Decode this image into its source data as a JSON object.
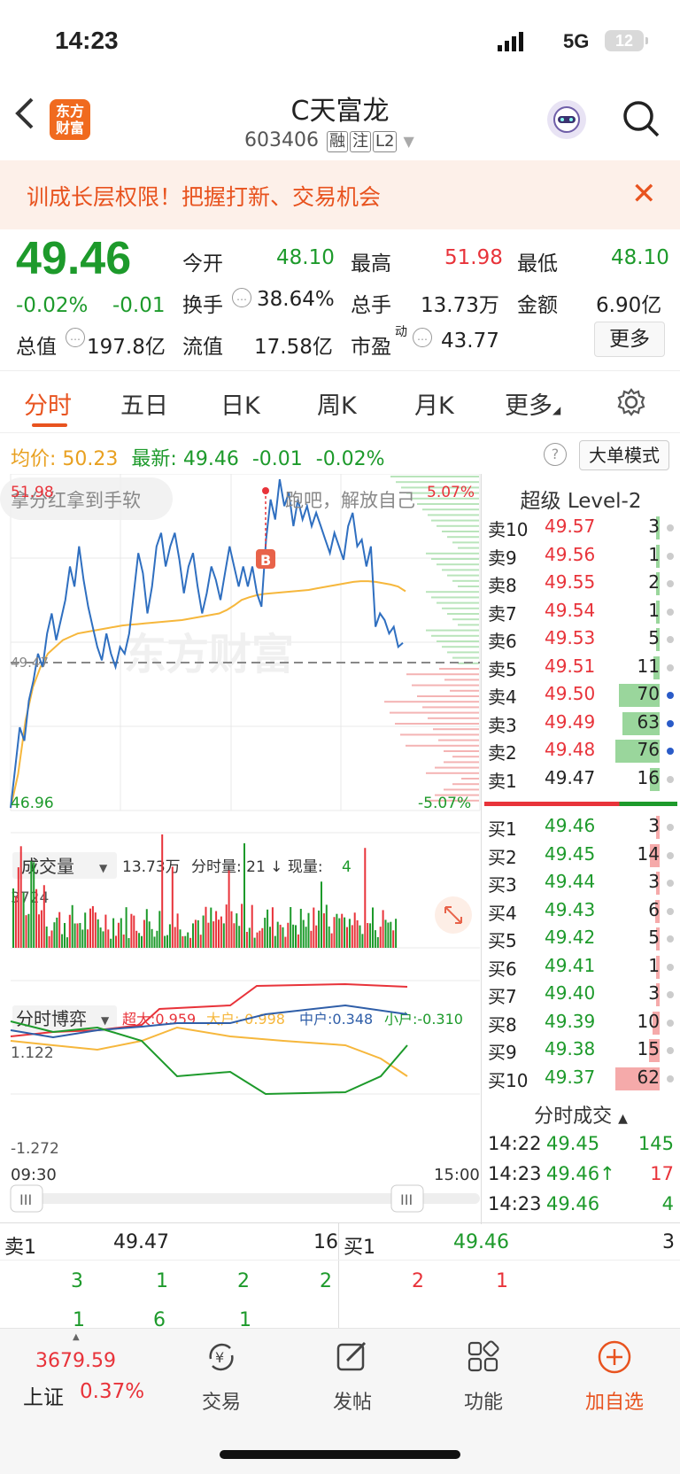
{
  "status_bar": {
    "time": "14:23",
    "network": "5G",
    "battery": "12"
  },
  "header": {
    "back_icon": "chevron-left-icon",
    "logo_text": "东方财富",
    "stock_name": "C天富龙",
    "stock_code": "603406",
    "tags": [
      "融",
      "注",
      "L2"
    ],
    "robot_icon": "robot-assistant-icon",
    "search_icon": "search-icon"
  },
  "banner": {
    "text": "训成长层权限！把握打新、交易机会",
    "close_icon": "close-icon"
  },
  "quote": {
    "price": "49.46",
    "change_pct": "-0.02%",
    "change": "-0.01",
    "open_label": "今开",
    "open": "48.10",
    "high_label": "最高",
    "high": "51.98",
    "low_label": "最低",
    "low": "48.10",
    "turnover_label": "换手",
    "turnover": "38.64%",
    "volume_label": "总手",
    "volume": "13.73万",
    "amount_label": "金额",
    "amount": "6.90亿",
    "mktcap_label": "总值",
    "mktcap": "197.8亿",
    "float_label": "流值",
    "float": "17.58亿",
    "pe_label": "市盈",
    "pe_sup": "动",
    "pe": "43.77",
    "more_button": "更多"
  },
  "tabs": [
    "分时",
    "五日",
    "日K",
    "周K",
    "月K",
    "更多"
  ],
  "settings_icon": "gear-icon",
  "chart_header": {
    "avg_label": "均价:",
    "avg_value": "50.23",
    "latest_label": "最新:",
    "latest_value": "49.46",
    "latest_change": "-0.01",
    "latest_pct": "-0.02%",
    "big_order_button": "大单模式"
  },
  "chart_labels": {
    "top_price": "51.98",
    "bottom_price": "46.96",
    "top_pct": "5.07%",
    "bottom_pct": "-5.07%",
    "mid_price": "49.47",
    "watermark": "东方财富",
    "overlay_left": "拿分红拿到手软",
    "overlay_right": "跑吧，解放自己",
    "b_marker": "B",
    "vol_select": "成交量",
    "vol_info_total": "13.73万",
    "vol_info_rest": "分时量: 21 ↓ 现量:",
    "vol_info_now": "4",
    "vol_max": "3724",
    "game_select": "分时博弈",
    "game_super": "超大:0.959",
    "game_large": "大户:-0.998",
    "game_mid": "中户:0.348",
    "game_small": "小户:-0.310",
    "game_max": "1.122",
    "game_min": "-1.272",
    "time_start": "09:30",
    "time_end": "15:00"
  },
  "chart_data": {
    "type": "line",
    "y_range": [
      46.96,
      51.98
    ],
    "pct_range": [
      "-5.07%",
      "5.07%"
    ],
    "reference_price": 49.47,
    "series": [
      {
        "name": "最新",
        "values": [
          47.0,
          47.6,
          48.2,
          48.0,
          48.6,
          48.9,
          49.3,
          49.1,
          49.6,
          49.9,
          49.5,
          49.8,
          50.1,
          50.6,
          50.3,
          50.9,
          50.4,
          50.0,
          49.7,
          49.4,
          49.2,
          49.6,
          49.3,
          49.1,
          49.4,
          49.3,
          49.6,
          50.2,
          50.8,
          50.5,
          49.9,
          50.3,
          50.9,
          51.1,
          50.6,
          50.9,
          51.1,
          50.7,
          50.2,
          50.6,
          50.8,
          50.3,
          49.9,
          50.2,
          50.6,
          50.4,
          50.1,
          50.5,
          50.9,
          50.6,
          50.3,
          50.6,
          50.3,
          50.6,
          50.2,
          50.0,
          51.0,
          51.6,
          51.3,
          51.9,
          51.5,
          51.7,
          51.2,
          51.6,
          51.3,
          51.5,
          51.2,
          51.4,
          51.2,
          51.0,
          50.8,
          51.1,
          50.9,
          50.7,
          51.2,
          51.4,
          50.9,
          51.0,
          50.6,
          50.9,
          49.7,
          49.9,
          49.8,
          49.6,
          49.7,
          49.4,
          49.46
        ]
      },
      {
        "name": "均价",
        "values": [
          47.0,
          47.5,
          48.3,
          48.8,
          49.1,
          49.3,
          49.4,
          49.5,
          49.55,
          49.6,
          49.62,
          49.64,
          49.66,
          49.68,
          49.7,
          49.72,
          49.73,
          49.74,
          49.75,
          49.76,
          49.77,
          49.78,
          49.79,
          49.8,
          49.82,
          49.84,
          49.86,
          49.88,
          49.9,
          49.95,
          50.02,
          50.1,
          50.14,
          50.17,
          50.19,
          50.2,
          50.21,
          50.22,
          50.23,
          50.24,
          50.25,
          50.27,
          50.29,
          50.31,
          50.33,
          50.35,
          50.37,
          50.38,
          50.38,
          50.37,
          50.35,
          50.33,
          50.3,
          50.23
        ]
      }
    ]
  },
  "order_book": {
    "title": "超级 Level-2",
    "asks": [
      {
        "label": "卖10",
        "price": "49.57",
        "vol": "3",
        "ratio": 0.04
      },
      {
        "label": "卖9",
        "price": "49.56",
        "vol": "1",
        "ratio": 0.01
      },
      {
        "label": "卖8",
        "price": "49.55",
        "vol": "2",
        "ratio": 0.03
      },
      {
        "label": "卖7",
        "price": "49.54",
        "vol": "1",
        "ratio": 0.01
      },
      {
        "label": "卖6",
        "price": "49.53",
        "vol": "5",
        "ratio": 0.07
      },
      {
        "label": "卖5",
        "price": "49.51",
        "vol": "11",
        "ratio": 0.14
      },
      {
        "label": "卖4",
        "price": "49.50",
        "vol": "70",
        "ratio": 0.92
      },
      {
        "label": "卖3",
        "price": "49.49",
        "vol": "63",
        "ratio": 0.83
      },
      {
        "label": "卖2",
        "price": "49.48",
        "vol": "76",
        "ratio": 1.0
      },
      {
        "label": "卖1",
        "price": "49.47",
        "vol": "16",
        "ratio": 0.21
      }
    ],
    "bids": [
      {
        "label": "买1",
        "price": "49.46",
        "vol": "3",
        "ratio": 0.05
      },
      {
        "label": "买2",
        "price": "49.45",
        "vol": "14",
        "ratio": 0.22
      },
      {
        "label": "买3",
        "price": "49.44",
        "vol": "3",
        "ratio": 0.05
      },
      {
        "label": "买4",
        "price": "49.43",
        "vol": "6",
        "ratio": 0.1
      },
      {
        "label": "买5",
        "price": "49.42",
        "vol": "5",
        "ratio": 0.08
      },
      {
        "label": "买6",
        "price": "49.41",
        "vol": "1",
        "ratio": 0.02
      },
      {
        "label": "买7",
        "price": "49.40",
        "vol": "3",
        "ratio": 0.05
      },
      {
        "label": "买8",
        "price": "49.39",
        "vol": "10",
        "ratio": 0.16
      },
      {
        "label": "买9",
        "price": "49.38",
        "vol": "15",
        "ratio": 0.24
      },
      {
        "label": "买10",
        "price": "49.37",
        "vol": "62",
        "ratio": 1.0
      }
    ]
  },
  "trades": {
    "title": "分时成交",
    "rows": [
      {
        "time": "14:22",
        "price": "49.45",
        "vol": "145",
        "dir": "down"
      },
      {
        "time": "14:23",
        "price": "49.46↑",
        "vol": "17",
        "dir": "up"
      },
      {
        "time": "14:23",
        "price": "49.46",
        "vol": "4",
        "dir": "down"
      }
    ]
  },
  "bottom_strip": {
    "ask_label": "卖1",
    "ask_price": "49.47",
    "ask_vol": "16",
    "bid_label": "买1",
    "bid_price": "49.46",
    "bid_vol": "3",
    "ask_queue_1": [
      "3",
      "1",
      "2",
      "2"
    ],
    "ask_queue_2": [
      "1",
      "6",
      "1"
    ],
    "bid_queue": [
      "2",
      "1"
    ]
  },
  "tab_bar": {
    "index_value": "3679.59",
    "index_name": "上证",
    "index_change": "0.37%",
    "items": [
      {
        "label": "交易",
        "icon": "yuan-exchange-icon"
      },
      {
        "label": "发帖",
        "icon": "edit-post-icon"
      },
      {
        "label": "功能",
        "icon": "grid-apps-icon"
      },
      {
        "label": "加自选",
        "icon": "add-circle-icon"
      }
    ]
  }
}
